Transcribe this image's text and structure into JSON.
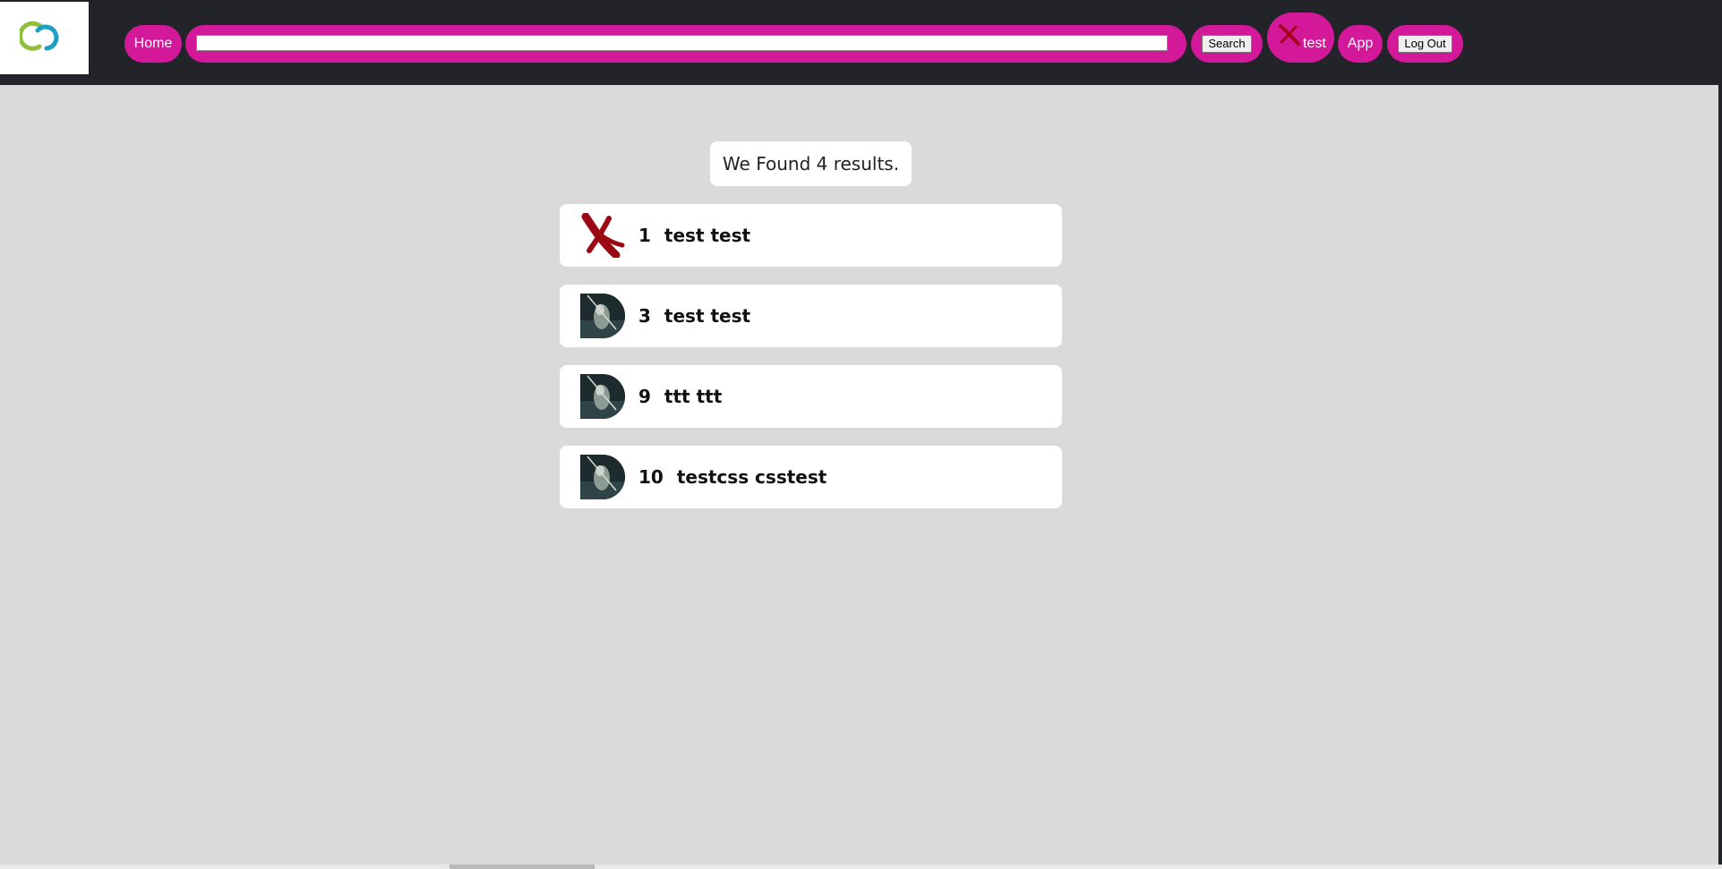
{
  "nav": {
    "home_label": "Home",
    "search_value": "",
    "search_button_label": "Search",
    "user_name": "test",
    "app_label": "App",
    "logout_label": "Log Out"
  },
  "results": {
    "summary": "We Found 4 results.",
    "items": [
      {
        "id": "1",
        "name": "test test",
        "avatar": "red-x-icon"
      },
      {
        "id": "3",
        "name": "test test",
        "avatar": "dark-photo"
      },
      {
        "id": "9",
        "name": "ttt ttt",
        "avatar": "dark-photo"
      },
      {
        "id": "10",
        "name": "testcss csstest",
        "avatar": "dark-photo"
      }
    ]
  },
  "colors": {
    "topbar": "#232429",
    "accent": "#d3199a",
    "background": "#dadada",
    "card": "#ffffff"
  }
}
